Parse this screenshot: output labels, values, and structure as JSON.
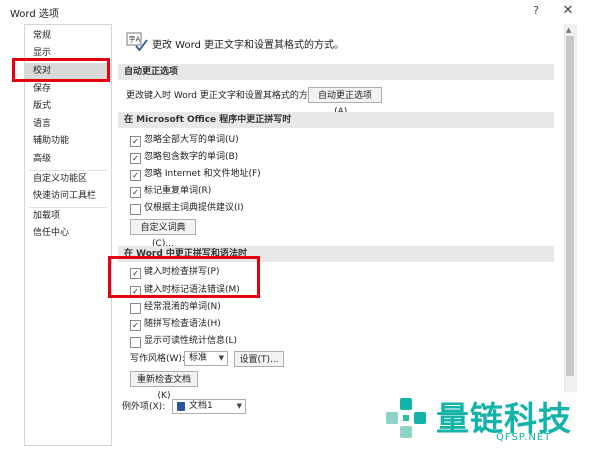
{
  "window": {
    "title": "Word 选项",
    "help": "?",
    "close": "✕"
  },
  "sidebar": {
    "items": [
      {
        "label": "常规"
      },
      {
        "label": "显示"
      },
      {
        "label": "校对",
        "active": true
      },
      {
        "label": "保存"
      },
      {
        "label": "版式"
      },
      {
        "label": "语言"
      },
      {
        "label": "辅助功能"
      },
      {
        "label": "高级"
      },
      {
        "label": "自定义功能区"
      },
      {
        "label": "快速访问工具栏"
      },
      {
        "label": "加载项"
      },
      {
        "label": "信任中心"
      }
    ]
  },
  "header": {
    "text": "更改 Word 更正文字和设置其格式的方式。",
    "icon": "abc-check-icon"
  },
  "autocorrect": {
    "title": "自动更正选项",
    "label": "更改键入时 Word 更正文字和设置其格式的方式:",
    "button": "自动更正选项(A)..."
  },
  "office_spelling": {
    "title": "在 Microsoft Office 程序中更正拼写时",
    "options": [
      {
        "label": "忽略全部大写的单词(U)",
        "checked": true
      },
      {
        "label": "忽略包含数字的单词(B)",
        "checked": true
      },
      {
        "label": "忽略 Internet 和文件地址(F)",
        "checked": true
      },
      {
        "label": "标记重复单词(R)",
        "checked": true
      },
      {
        "label": "仅根据主词典提供建议(I)",
        "checked": false
      }
    ],
    "dict_button": "自定义词典(C)..."
  },
  "word_spelling": {
    "title": "在 Word 中更正拼写和语法时",
    "options": [
      {
        "label": "键入时检查拼写(P)",
        "checked": true
      },
      {
        "label": "键入时标记语法错误(M)",
        "checked": true
      },
      {
        "label": "经常混淆的单词(N)",
        "checked": false
      },
      {
        "label": "随拼写检查语法(H)",
        "checked": true
      },
      {
        "label": "显示可读性统计信息(L)",
        "checked": false
      }
    ],
    "style_label": "写作风格(W):",
    "style_value": "标准",
    "settings_button": "设置(T)...",
    "recheck_button": "重新检查文档(K)"
  },
  "exceptions": {
    "label": "例外项(X):",
    "value": "文档1"
  },
  "watermark": {
    "cn": "量链科技",
    "en": "QFSP.NET"
  },
  "colors": {
    "highlight": "#e3000f",
    "watermark": "#12b3a8",
    "section_bg": "#e8e8e8"
  }
}
